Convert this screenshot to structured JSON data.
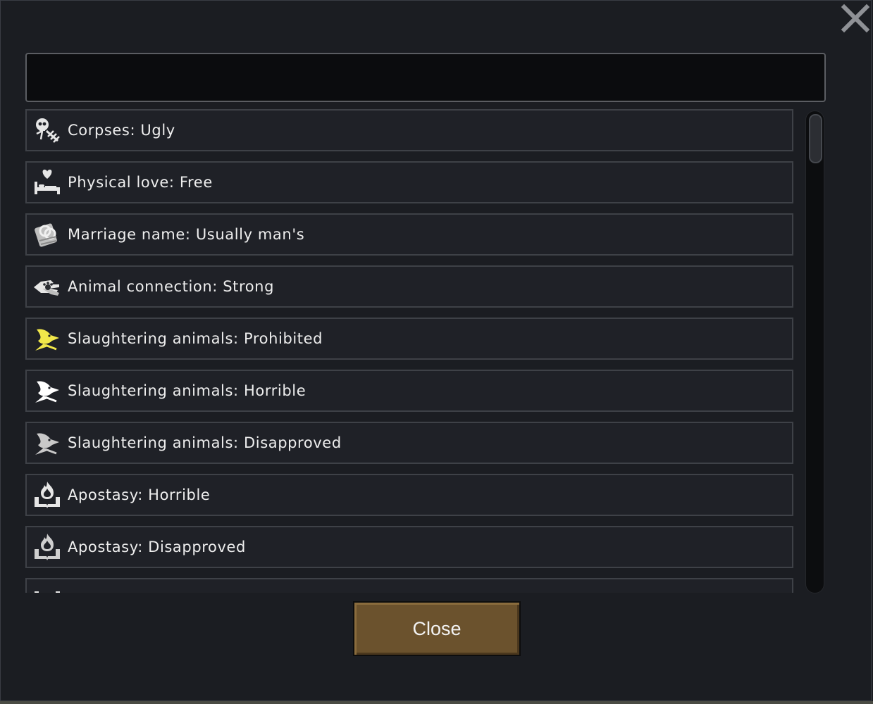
{
  "search": {
    "value": "",
    "placeholder": ""
  },
  "rows": [
    {
      "label": "Corpses: Ugly",
      "icon": "skeleton-icon"
    },
    {
      "label": "Physical love: Free",
      "icon": "bed-heart-icon"
    },
    {
      "label": "Marriage name: Usually man's",
      "icon": "scroll-rings-icon"
    },
    {
      "label": "Animal connection: Strong",
      "icon": "hand-paw-icon"
    },
    {
      "label": "Slaughtering animals: Prohibited",
      "icon": "bird-knife-icon",
      "icon_color": "#f2e84a"
    },
    {
      "label": "Slaughtering animals: Horrible",
      "icon": "bird-knife-icon",
      "icon_color": "#ffffff"
    },
    {
      "label": "Slaughtering animals: Disapproved",
      "icon": "bird-knife-icon",
      "icon_color": "#c9c9c9"
    },
    {
      "label": "Apostasy: Horrible",
      "icon": "flame-book-icon"
    },
    {
      "label": "Apostasy: Disapproved",
      "icon": "flame-book-icon"
    },
    {
      "label": "",
      "icon": "book-icon"
    }
  ],
  "close_button": {
    "label": "Close"
  },
  "colors": {
    "background": "#1b1d22",
    "row_background": "#1f2127",
    "row_border": "#3e4147",
    "button": "#6b522d"
  }
}
